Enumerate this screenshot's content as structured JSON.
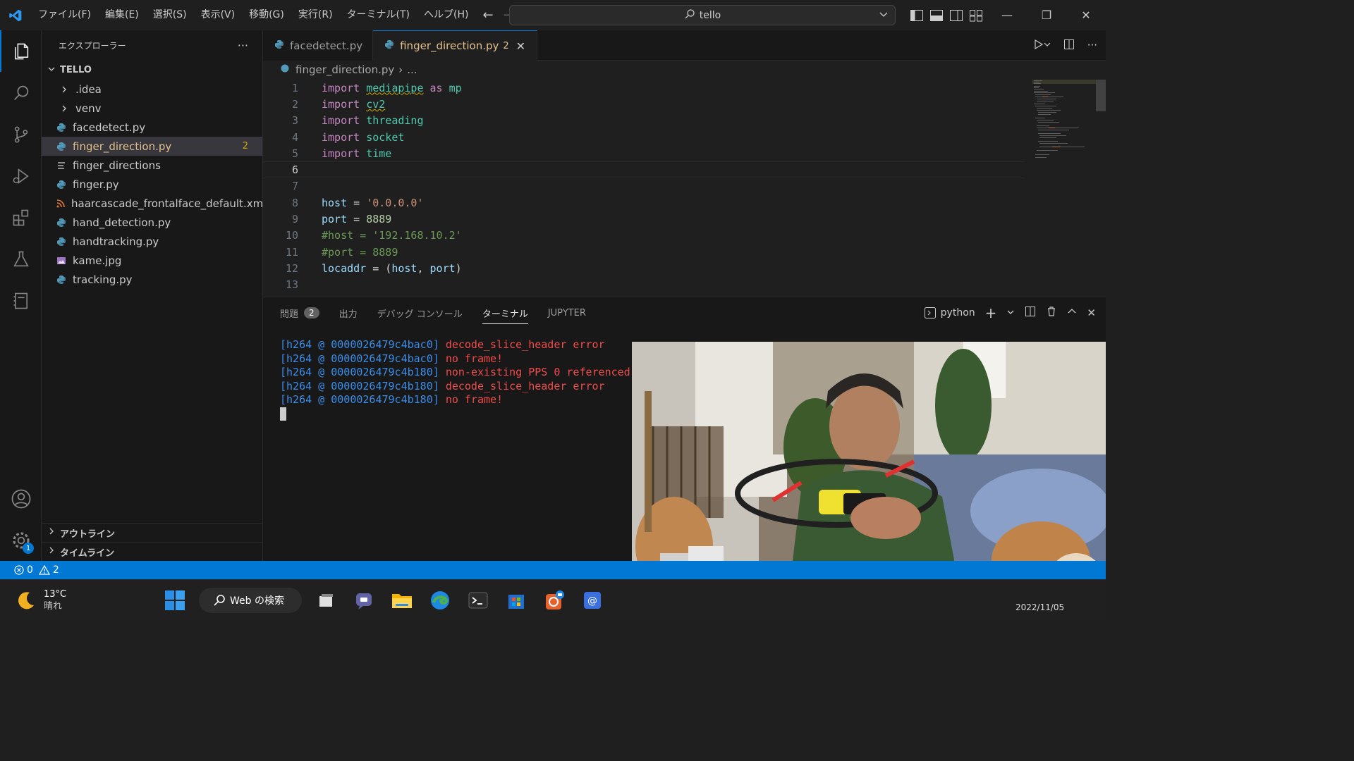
{
  "titlebar": {
    "menu": [
      "ファイル(F)",
      "編集(E)",
      "選択(S)",
      "表示(V)",
      "移動(G)",
      "実行(R)",
      "ターミナル(T)",
      "ヘルプ(H)"
    ],
    "search": "tello",
    "nav_back": "←",
    "nav_forward": "→"
  },
  "activity_bar": {
    "items": [
      "explorer",
      "search",
      "source-control",
      "run-debug",
      "extensions",
      "testing",
      "notebook"
    ],
    "settings_badge": "1"
  },
  "sidebar": {
    "title": "エクスプローラー",
    "more": "···",
    "root": "TELLO",
    "items": [
      {
        "name": ".idea",
        "type": "folder"
      },
      {
        "name": "venv",
        "type": "folder"
      },
      {
        "name": "facedetect.py",
        "type": "python"
      },
      {
        "name": "finger_direction.py",
        "type": "python",
        "selected": true,
        "badge": "2"
      },
      {
        "name": "finger_directions",
        "type": "text"
      },
      {
        "name": "finger.py",
        "type": "python"
      },
      {
        "name": "haarcascade_frontalface_default.xml",
        "type": "xml"
      },
      {
        "name": "hand_detection.py",
        "type": "python"
      },
      {
        "name": "handtracking.py",
        "type": "python"
      },
      {
        "name": "kame.jpg",
        "type": "image"
      },
      {
        "name": "tracking.py",
        "type": "python"
      }
    ],
    "outline": "アウトライン",
    "timeline": "タイムライン"
  },
  "editor": {
    "tabs": [
      {
        "label": "facedetect.py",
        "active": false
      },
      {
        "label": "finger_direction.py",
        "active": true,
        "badge": "2"
      }
    ],
    "breadcrumb": [
      "finger_direction.py",
      "..."
    ],
    "current_line": 6,
    "lines": [
      {
        "n": "1",
        "tokens": [
          [
            "kw",
            "import "
          ],
          [
            "mod squig",
            "mediapipe"
          ],
          [
            "kw",
            " as "
          ],
          [
            "mod",
            "mp"
          ]
        ]
      },
      {
        "n": "2",
        "tokens": [
          [
            "kw",
            "import "
          ],
          [
            "mod squig",
            "cv2"
          ]
        ]
      },
      {
        "n": "3",
        "tokens": [
          [
            "kw",
            "import "
          ],
          [
            "mod",
            "threading"
          ]
        ]
      },
      {
        "n": "4",
        "tokens": [
          [
            "kw",
            "import "
          ],
          [
            "mod",
            "socket"
          ]
        ]
      },
      {
        "n": "5",
        "tokens": [
          [
            "kw",
            "import "
          ],
          [
            "mod",
            "time"
          ]
        ]
      },
      {
        "n": "6",
        "tokens": []
      },
      {
        "n": "7",
        "tokens": []
      },
      {
        "n": "8",
        "tokens": [
          [
            "var",
            "host"
          ],
          [
            "plain",
            " = "
          ],
          [
            "str",
            "'0.0.0.0'"
          ]
        ]
      },
      {
        "n": "9",
        "tokens": [
          [
            "var",
            "port"
          ],
          [
            "plain",
            " = "
          ],
          [
            "num",
            "8889"
          ]
        ]
      },
      {
        "n": "10",
        "tokens": [
          [
            "cmt",
            "#host = '192.168.10.2'"
          ]
        ]
      },
      {
        "n": "11",
        "tokens": [
          [
            "cmt",
            "#port = 8889"
          ]
        ]
      },
      {
        "n": "12",
        "tokens": [
          [
            "var",
            "locaddr"
          ],
          [
            "plain",
            " = ("
          ],
          [
            "var",
            "host"
          ],
          [
            "plain",
            ", "
          ],
          [
            "var",
            "port"
          ],
          [
            "plain",
            ")"
          ]
        ]
      },
      {
        "n": "13",
        "tokens": []
      }
    ]
  },
  "panel": {
    "tabs": [
      {
        "label": "問題",
        "badge": "2"
      },
      {
        "label": "出力"
      },
      {
        "label": "デバッグ コンソール"
      },
      {
        "label": "ターミナル",
        "active": true
      },
      {
        "label": "JUPYTER"
      }
    ],
    "terminal_name": "python",
    "terminal_lines": [
      {
        "prefix": "[h264 @ 0000026479c4bac0]",
        "msg": "decode_slice_header error"
      },
      {
        "prefix": "[h264 @ 0000026479c4bac0]",
        "msg": "no frame!"
      },
      {
        "prefix": "[h264 @ 0000026479c4b180]",
        "msg": "non-existing PPS 0 referenced"
      },
      {
        "prefix": "[h264 @ 0000026479c4b180]",
        "msg": "decode_slice_header error"
      },
      {
        "prefix": "[h264 @ 0000026479c4b180]",
        "msg": "no frame!"
      }
    ]
  },
  "video_overlay": {
    "description": "Webcam video of a man holding a small yellow-and-black drone, with a guitar and a dog in the room"
  },
  "statusbar": {
    "errors": "0",
    "warnings": "2"
  },
  "taskbar": {
    "weather_temp": "13°C",
    "weather_desc": "晴れ",
    "search_label": "Web の検索",
    "date_partial": "2022/11/05"
  },
  "colors": {
    "accent": "#0078d4",
    "modified_tab": "#e2c08d",
    "error": "#f14c4c",
    "terminal_prefix": "#3b8eea"
  }
}
